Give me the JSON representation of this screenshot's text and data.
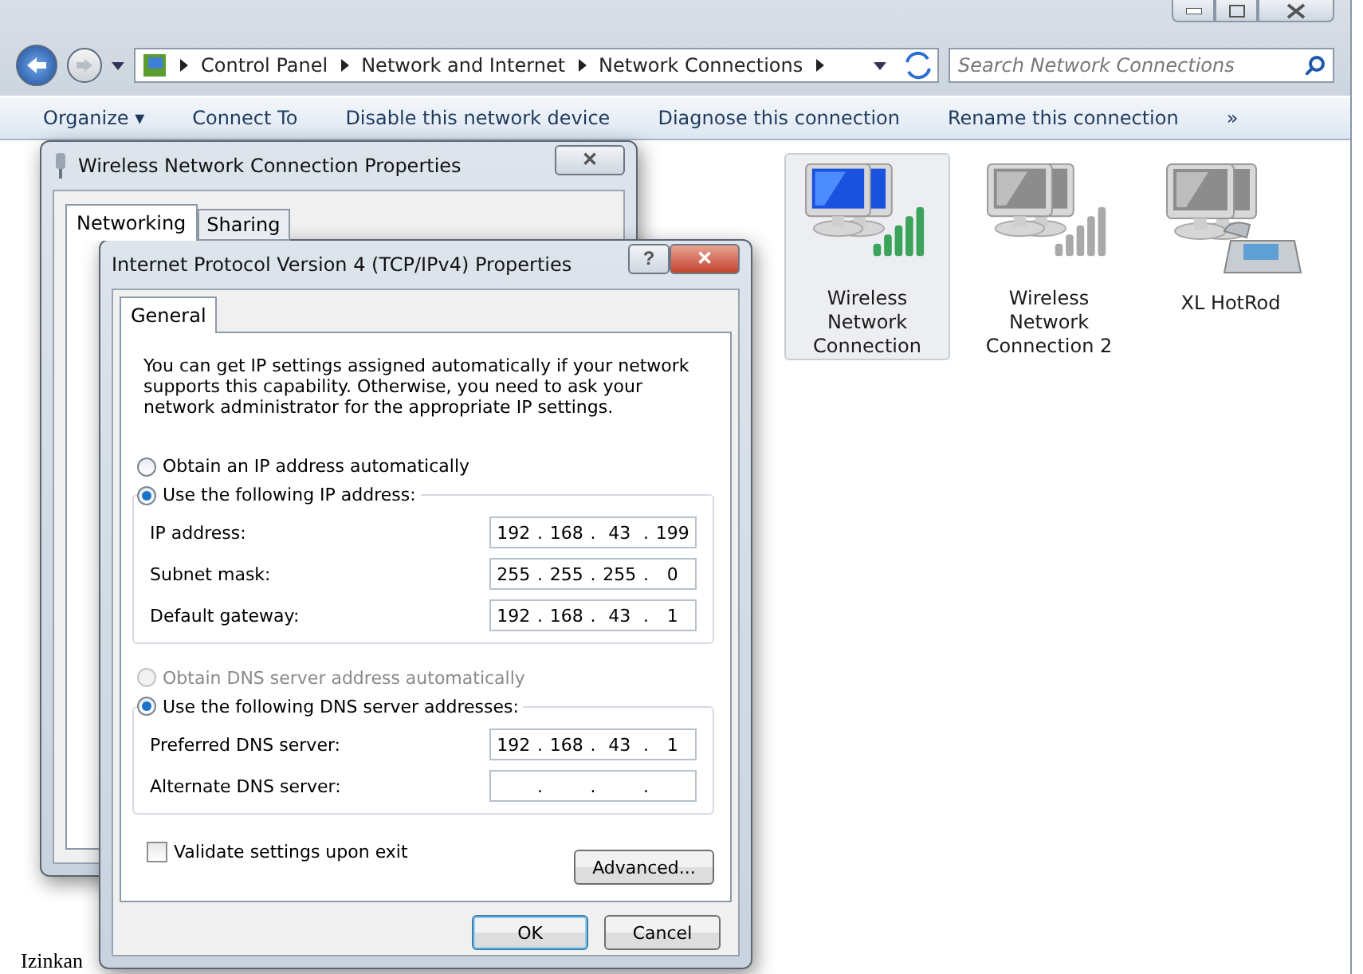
{
  "explorer": {
    "breadcrumb": [
      "Control Panel",
      "Network and Internet",
      "Network Connections"
    ],
    "search": {
      "placeholder": "Search Network Connections"
    },
    "toolbar": [
      "Organize ▾",
      "Connect To",
      "Disable this network device",
      "Diagnose this connection",
      "Rename this connection"
    ],
    "overflow": "»",
    "connections": [
      {
        "name": "Wireless Network Connection",
        "kind": "wireless",
        "connected": true,
        "selected": true
      },
      {
        "name": "Wireless Network Connection 2",
        "kind": "wireless",
        "connected": false,
        "selected": false
      },
      {
        "name": "XL HotRod",
        "kind": "dialup",
        "connected": false,
        "selected": false
      }
    ]
  },
  "properties_dialog": {
    "title": "Wireless Network Connection Properties",
    "close": "✕",
    "tabs": [
      {
        "label": "Networking",
        "selected": true
      },
      {
        "label": "Sharing",
        "selected": false
      }
    ]
  },
  "ipv4_dialog": {
    "title": "Internet Protocol Version 4 (TCP/IPv4) Properties",
    "help": "?",
    "close": "✕",
    "tabs": [
      {
        "label": "General",
        "selected": true
      }
    ],
    "intro": "You can get IP settings assigned automatically if your network supports this capability. Otherwise, you need to ask your network administrator for the appropriate IP settings.",
    "ip_choice": [
      {
        "label": "Obtain an IP address automatically",
        "selected": false,
        "disabled": false
      },
      {
        "label": "Use the following IP address:",
        "selected": true,
        "disabled": false
      }
    ],
    "ip_fields": [
      {
        "label": "IP address:",
        "dot": ".",
        "octets": [
          "192",
          "168",
          "43",
          "199"
        ]
      },
      {
        "label": "Subnet mask:",
        "dot": ".",
        "octets": [
          "255",
          "255",
          "255",
          "0"
        ]
      },
      {
        "label": "Default gateway:",
        "dot": ".",
        "octets": [
          "192",
          "168",
          "43",
          "1"
        ]
      }
    ],
    "dns_choice": [
      {
        "label": "Obtain DNS server address automatically",
        "selected": false,
        "disabled": true
      },
      {
        "label": "Use the following DNS server addresses:",
        "selected": true,
        "disabled": false
      }
    ],
    "dns_fields": [
      {
        "label": "Preferred DNS server:",
        "dot": ".",
        "octets": [
          "192",
          "168",
          "43",
          "1"
        ]
      },
      {
        "label": "Alternate DNS server:",
        "dot": "."
      }
    ],
    "validate": {
      "label": "Validate settings upon exit",
      "checked": false
    },
    "advanced": "Advanced...",
    "buttons": [
      {
        "label": "OK",
        "default": true
      },
      {
        "label": "Cancel",
        "default": false
      }
    ]
  },
  "desktop_text": "Izinkan"
}
